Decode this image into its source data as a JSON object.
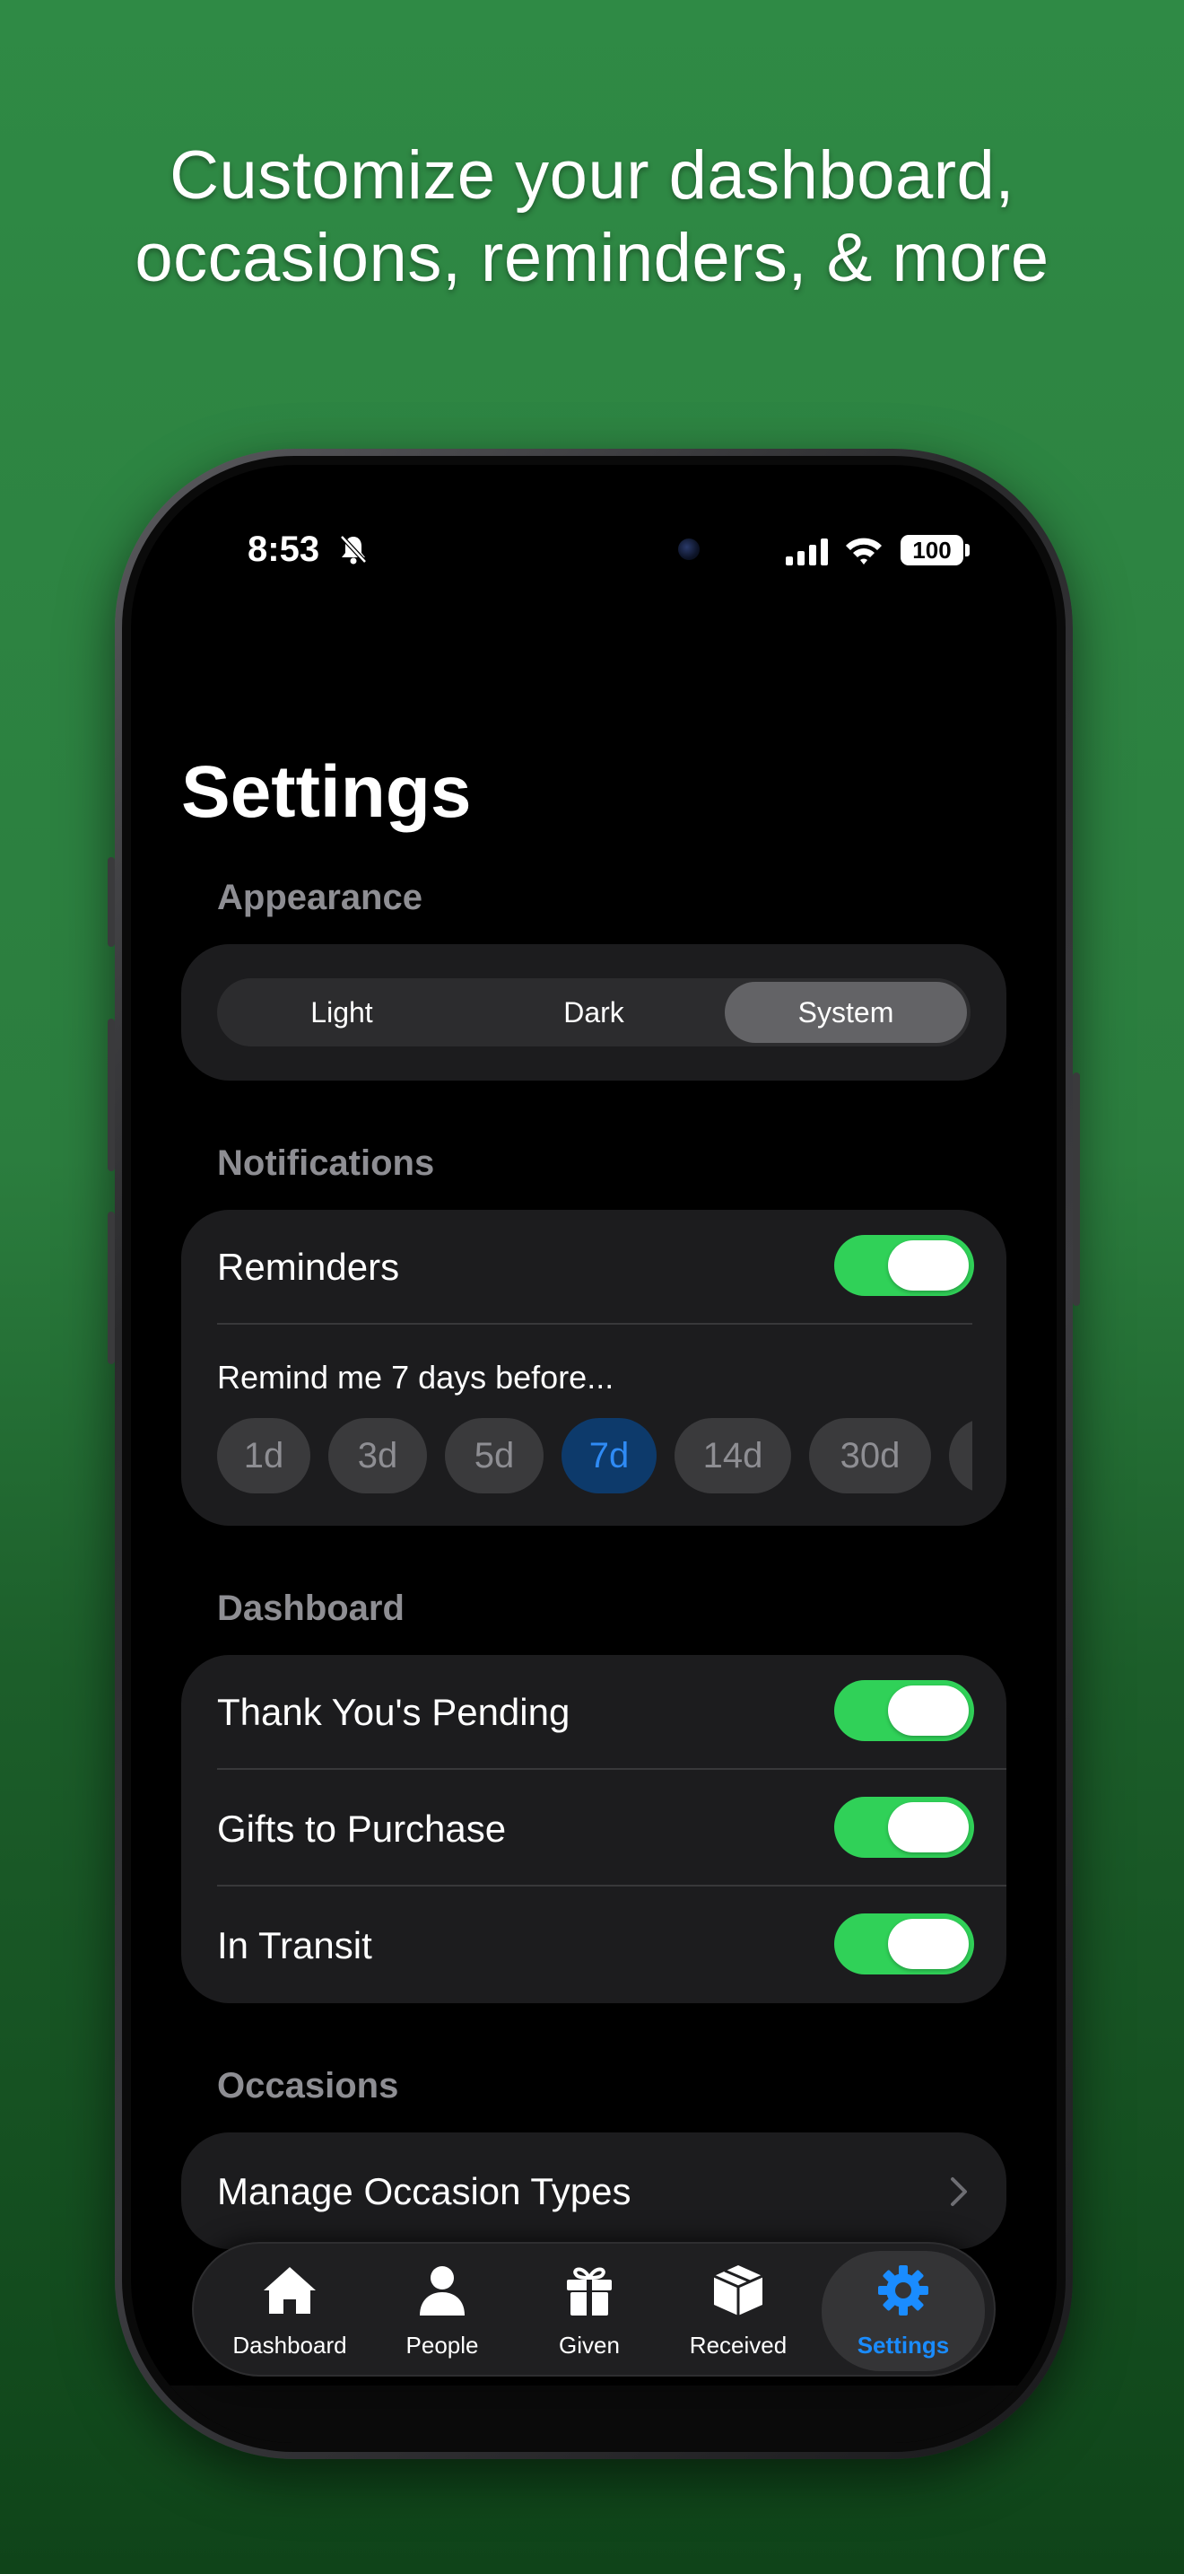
{
  "headline": {
    "line1": "Customize your dashboard,",
    "line2": "occasions, reminders, & more"
  },
  "status_bar": {
    "time": "8:53",
    "battery": "100"
  },
  "page_title": "Settings",
  "appearance": {
    "label": "Appearance",
    "options": [
      "Light",
      "Dark",
      "System"
    ],
    "selected": "System"
  },
  "notifications": {
    "label": "Notifications",
    "reminders_label": "Reminders",
    "reminders_on": true,
    "remind_text": "Remind me 7 days before...",
    "chips": [
      "1d",
      "3d",
      "5d",
      "7d",
      "14d",
      "30d"
    ],
    "selected_chip": "7d"
  },
  "dashboard": {
    "label": "Dashboard",
    "items": [
      {
        "label": "Thank You's Pending",
        "on": true
      },
      {
        "label": "Gifts to Purchase",
        "on": true
      },
      {
        "label": "In Transit",
        "on": true
      }
    ]
  },
  "occasions": {
    "label": "Occasions",
    "manage_label": "Manage Occasion Types"
  },
  "tabbar": {
    "tabs": [
      "Dashboard",
      "People",
      "Given",
      "Received",
      "Settings"
    ],
    "active": "Settings"
  },
  "colors": {
    "toggle_on": "#30d158",
    "accent_blue": "#1a8cff",
    "background_green": "#2f8a45"
  }
}
